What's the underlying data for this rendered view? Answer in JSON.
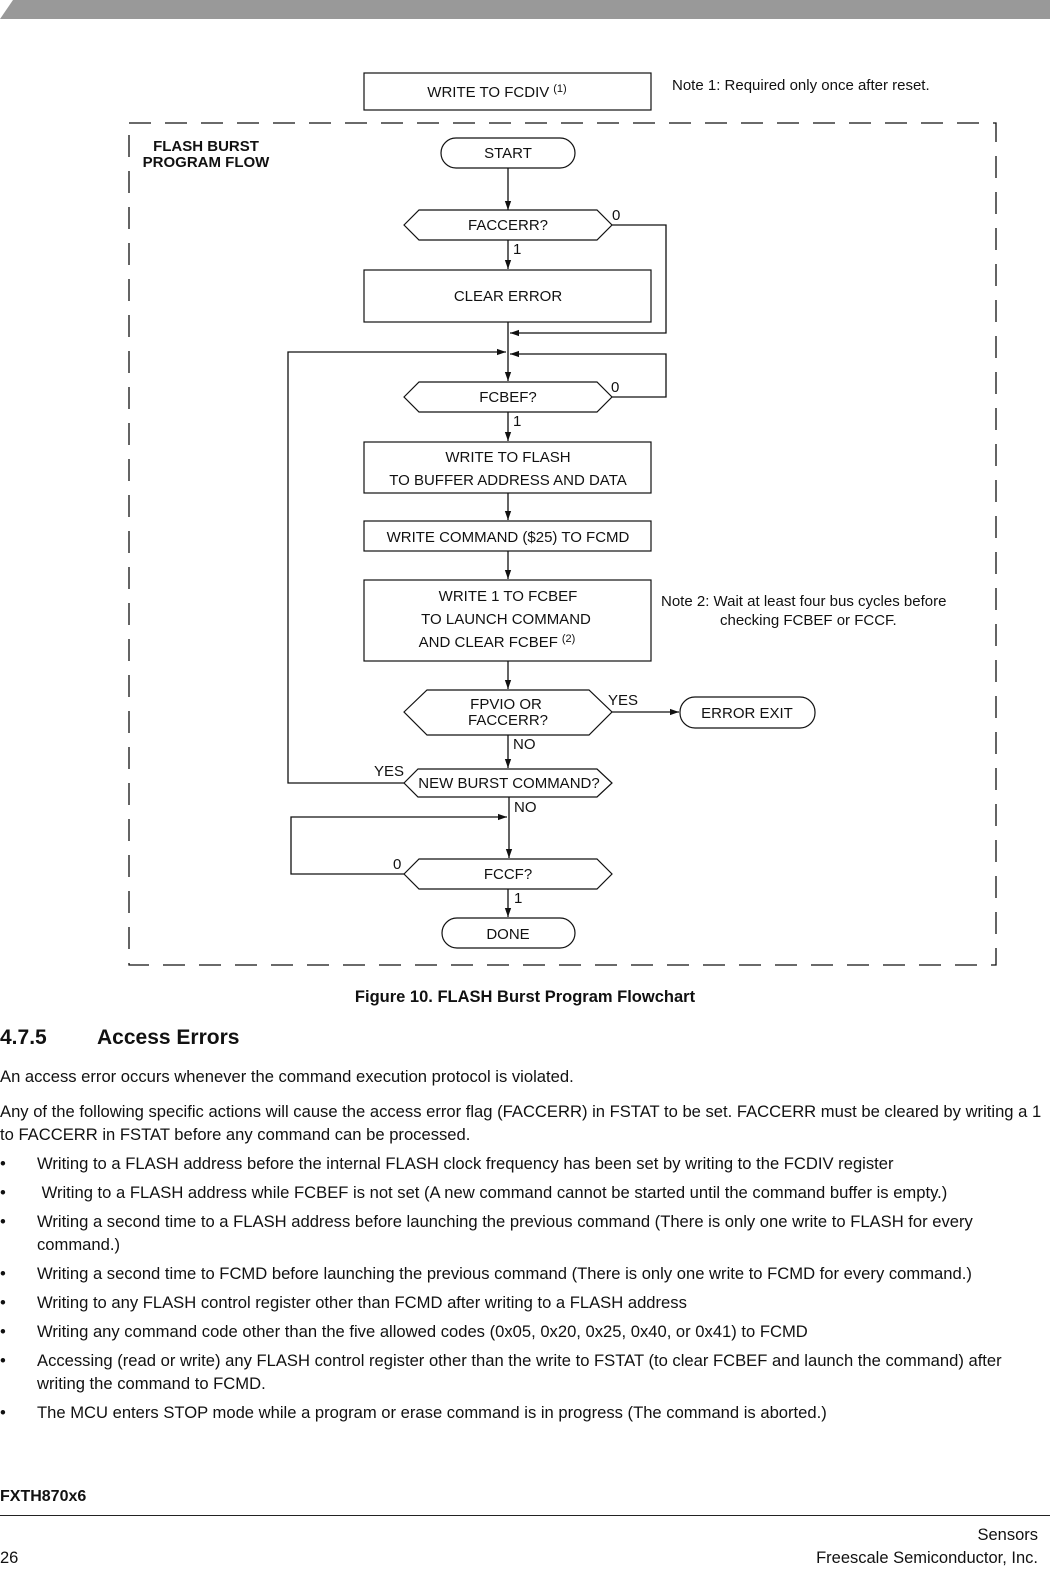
{
  "flowchart": {
    "group_label_line1": "FLASH BURST",
    "group_label_line2": "PROGRAM FLOW",
    "pre_step": {
      "text": "WRITE TO FCDIV",
      "sup": "(1)"
    },
    "note1": "Note 1: Required only once after reset.",
    "note2_line1": "Note 2: Wait at least four bus cycles before",
    "note2_line2": "checking FCBEF or FCCF.",
    "start": "START",
    "decision_faccerr": "FACCERR?",
    "faccerr_no": "0",
    "faccerr_yes": "1",
    "clear_error": "CLEAR ERROR",
    "decision_fcbef": "FCBEF?",
    "fcbef_no": "0",
    "fcbef_yes": "1",
    "write_flash_line1": "WRITE TO FLASH",
    "write_flash_line2": "TO BUFFER ADDRESS AND DATA",
    "write_command": "WRITE COMMAND ($25) TO FCMD",
    "write_fcbef_line1": "WRITE 1 TO FCBEF",
    "write_fcbef_line2": "TO LAUNCH COMMAND",
    "write_fcbef_line3": "AND CLEAR FCBEF",
    "write_fcbef_sup": "(2)",
    "decision_fpvio_line1": "FPVIO OR",
    "decision_fpvio_line2": "FACCERR?",
    "fpvio_yes": "YES",
    "fpvio_no": "NO",
    "error_exit": "ERROR EXIT",
    "decision_new_burst": "NEW BURST COMMAND?",
    "new_burst_yes": "YES",
    "new_burst_no": "NO",
    "decision_fccf": "FCCF?",
    "fccf_no": "0",
    "fccf_yes": "1",
    "done": "DONE"
  },
  "caption": "Figure 10. FLASH Burst Program Flowchart",
  "section": {
    "number": "4.7.5",
    "title": "Access Errors"
  },
  "paragraphs": [
    "An access error occurs whenever the command execution protocol is violated.",
    "Any of the following specific actions will cause the access error flag (FACCERR) in FSTAT to be set. FACCERR must be cleared by writing a 1 to FACCERR in FSTAT   before any command can be processed."
  ],
  "bullet_glyph": "•",
  "bullets": [
    "Writing to a FLASH address before the internal FLASH clock frequency has been set by writing to the FCDIV register",
    " Writing to a FLASH address while FCBEF is not set (A new command cannot be started until the command buffer is empty.)",
    "Writing a second time to a FLASH address before launching the previous command (There is only one write to FLASH for every command.)",
    "Writing a second time to FCMD before launching the previous command (There is only one write to FCMD for every command.)",
    "Writing to any FLASH control register other than FCMD after writing to a FLASH address",
    "Writing any command code other than the five allowed codes (0x05, 0x20, 0x25, 0x40, or 0x41) to FCMD",
    "Accessing (read or write) any FLASH control register other than the write to FSTAT (to clear FCBEF and launch the command) after writing the command to FCMD.",
    "The MCU enters STOP mode while a program or erase command is in progress (The command is aborted.)"
  ],
  "footer": {
    "doc_id": "FXTH870x6",
    "category": "Sensors",
    "page_number": "26",
    "company": "Freescale Semiconductor, Inc."
  },
  "colors": {
    "header_bar": "#999999",
    "line": "#111111"
  }
}
